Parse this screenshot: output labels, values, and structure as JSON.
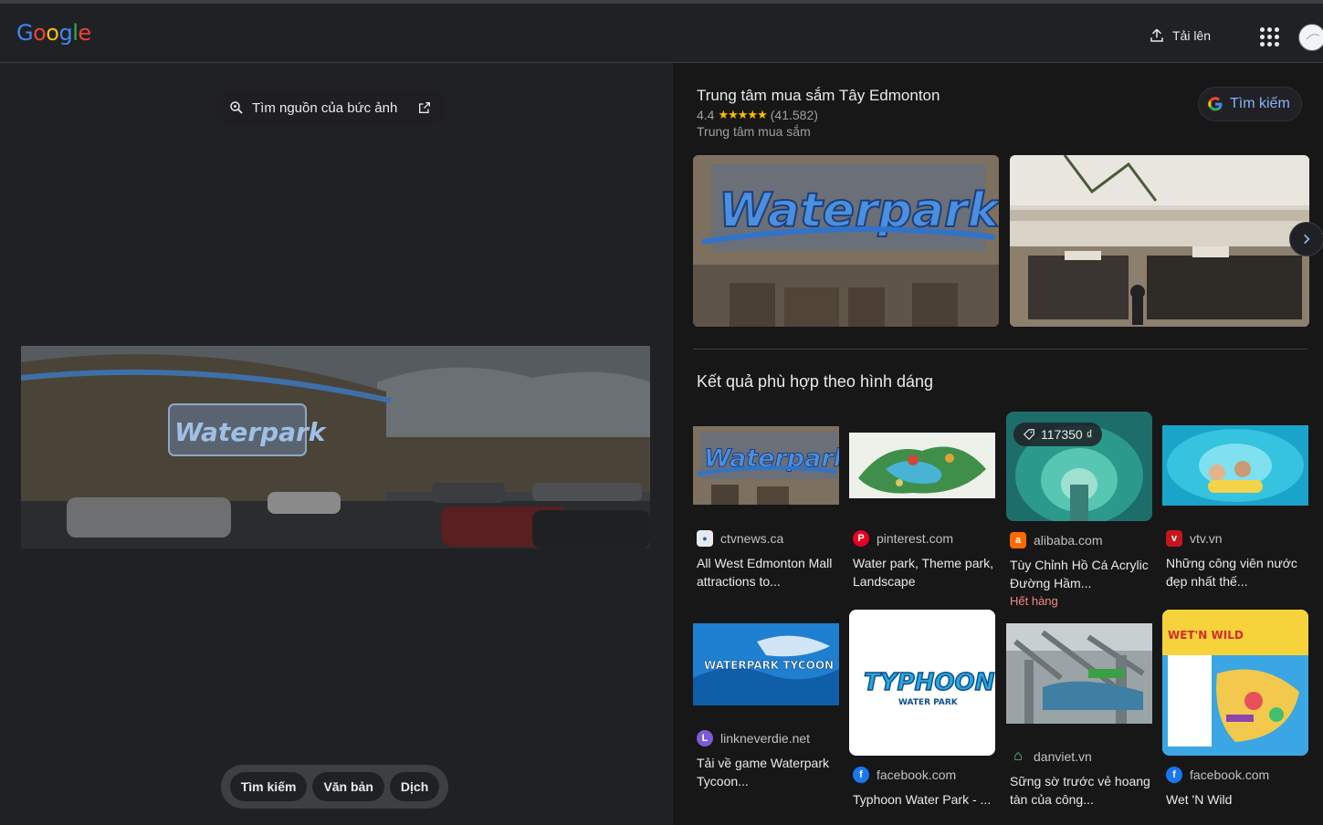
{
  "header": {
    "logo_letters": [
      "G",
      "o",
      "o",
      "g",
      "l",
      "e"
    ],
    "logo_colors": [
      "#4285f4",
      "#ea4335",
      "#fbbc04",
      "#4285f4",
      "#34a853",
      "#ea4335"
    ],
    "upload_label": "Tải lên",
    "apps_icon": "apps-grid-icon",
    "avatar_icon": "avatar"
  },
  "left": {
    "source_label": "Tìm nguồn của bức ảnh",
    "query_image_text": "Waterpark",
    "toolbar": [
      "Tìm kiếm",
      "Văn bản",
      "Dịch"
    ]
  },
  "knowledge_panel": {
    "title": "Trung tâm mua sắm Tây Edmonton",
    "rating": "4.4",
    "stars": "★★★★★",
    "review_count": "(41.582)",
    "type": "Trung tâm mua sắm",
    "search_label": "Tìm kiếm",
    "image1_text": "Waterpark"
  },
  "visual_matches": {
    "title": "Kết quả phù hợp theo hình dáng",
    "items": [
      {
        "source": "ctvnews.ca",
        "caption": "All West Edmonton Mall attractions to...",
        "thumb_text": "Waterpark"
      },
      {
        "source": "pinterest.com",
        "caption": "Water park, Theme park, Landscape"
      },
      {
        "source": "alibaba.com",
        "caption": "Tùy Chỉnh Hồ Cá Acrylic Đường Hầm...",
        "price": "117350 ₫",
        "stock": "Hết hàng"
      },
      {
        "source": "vtv.vn",
        "caption": "Những công viên nước đẹp nhất thế..."
      },
      {
        "source": "linkneverdie.net",
        "caption": "Tải về game Waterpark Tycoon...",
        "thumb_text": "WATERPARK TYCOON"
      },
      {
        "source": "facebook.com",
        "caption": "Typhoon Water Park - ...",
        "thumb_text": "TYPHOON",
        "thumb_sub": "WATER PARK"
      },
      {
        "source": "danviet.vn",
        "caption": "Sững sờ trước vẻ hoang tàn của công..."
      },
      {
        "source": "facebook.com",
        "caption": "Wet 'N Wild",
        "thumb_text": "WET'N WILD"
      }
    ]
  },
  "colors": {
    "background": "#202124",
    "panel": "#171717",
    "link_blue": "#8ab4f8",
    "star_yellow": "#fbbc04",
    "out_of_stock": "#f28b82"
  }
}
